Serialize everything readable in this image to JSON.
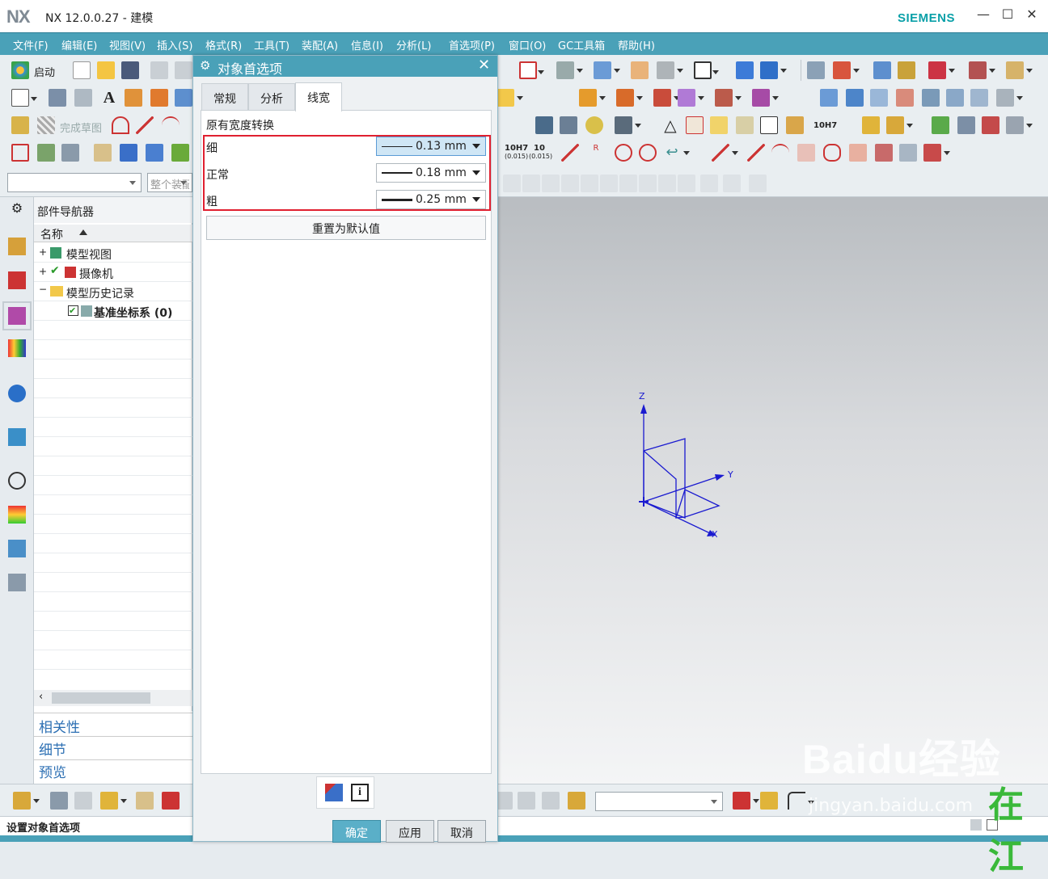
{
  "window": {
    "logo": "NX",
    "title": "NX 12.0.0.27 - 建模",
    "brand": "SIEMENS",
    "minimize": "—",
    "maximize": "☐",
    "close": "✕"
  },
  "menu": [
    "文件(F)",
    "编辑(E)",
    "视图(V)",
    "插入(S)",
    "格式(R)",
    "工具(T)",
    "装配(A)",
    "信息(I)",
    "分析(L)",
    "首选项(P)",
    "窗口(O)",
    "GC工具箱",
    "帮助(H)"
  ],
  "toolbar": {
    "start_label": "启动",
    "finish_sketch": "完成草图",
    "filter_select": "",
    "assembly_select": "整个装配",
    "tol1": "10H7",
    "tol2": "10",
    "tol2sub": "(0.015)",
    "tol3": "10H7",
    "tol4": "10H7"
  },
  "navigator": {
    "title": "部件导航器",
    "column": "名称",
    "items": [
      {
        "label": "模型视图"
      },
      {
        "label": "摄像机"
      },
      {
        "label": "模型历史记录"
      },
      {
        "label": "基准坐标系 (0)"
      }
    ],
    "panels": [
      "相关性",
      "细节",
      "预览"
    ]
  },
  "dialog": {
    "title": "对象首选项",
    "close": "✕",
    "tabs": [
      "常规",
      "分析",
      "线宽"
    ],
    "active_tab": "线宽",
    "group_title": "原有宽度转换",
    "rows": [
      {
        "label": "细",
        "value": "0.13 mm"
      },
      {
        "label": "正常",
        "value": "0.18 mm"
      },
      {
        "label": "粗",
        "value": "0.25 mm"
      }
    ],
    "reset_label": "重置为默认值",
    "ok": "确定",
    "apply": "应用",
    "cancel": "取消"
  },
  "viewport": {
    "axis_x": "X",
    "axis_y": "Y",
    "axis_z": "Z",
    "csys_color": "#1a1ad0"
  },
  "status": {
    "text": "设置对象首选项"
  },
  "watermark": {
    "brand": "Baidu经验",
    "url": "jingyan.baidu.com",
    "corner": "在江"
  },
  "colors": {
    "accent": "#4aa1b8",
    "highlight": "#e02030",
    "brand": "#0aa0a8"
  }
}
